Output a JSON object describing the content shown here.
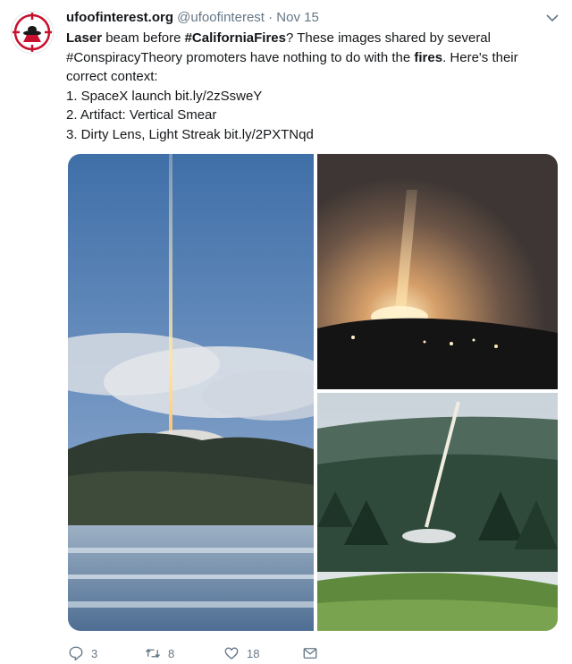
{
  "author": {
    "name": "ufoofinterest.org",
    "handle": "@ufoofinterest",
    "separator": "·",
    "date": "Nov 15",
    "avatar_icon": "ufo-target-logo",
    "avatar_color": "#c8102e"
  },
  "tweet": {
    "line1": {
      "w1": "Laser",
      "t1": " beam before ",
      "w2": "#CaliforniaFires",
      "t2": "? These images shared by several"
    },
    "line2": {
      "t1": "#ConspiracyTheory promoters have nothing to do with the ",
      "w1": "fires",
      "t2": ". Here's their"
    },
    "line3": "correct context:",
    "item1": "1. SpaceX launch bit.ly/2zSsweY",
    "item2": "2. Artifact: Vertical Smear",
    "item3": "3. Dirty Lens, Light Streak bit.ly/2PXTNqd"
  },
  "media": {
    "photos": [
      {
        "scene": "light-beam-over-hills-and-lake"
      },
      {
        "scene": "night-light-pillar-glow"
      },
      {
        "scene": "light-streak-over-forest"
      }
    ]
  },
  "actions": {
    "reply": {
      "icon": "reply-icon",
      "count": "3"
    },
    "retweet": {
      "icon": "retweet-icon",
      "count": "8"
    },
    "like": {
      "icon": "heart-icon",
      "count": "18"
    },
    "message": {
      "icon": "envelope-icon"
    }
  },
  "colors": {
    "text": "#14171a",
    "secondary": "#657786",
    "border": "#e1e8ed"
  }
}
